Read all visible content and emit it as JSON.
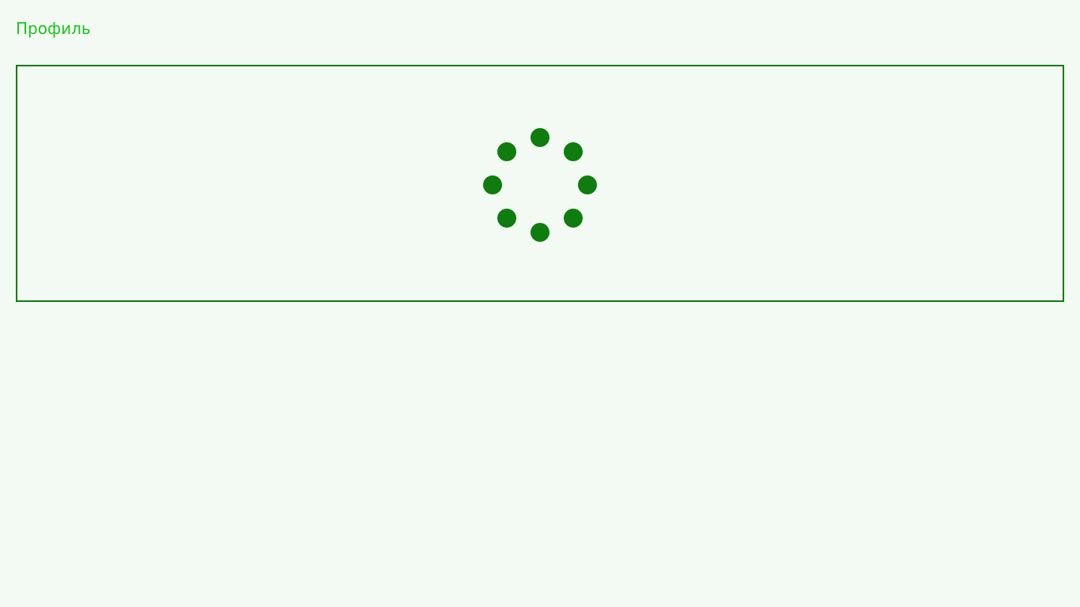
{
  "header": {
    "title": "Профиль"
  },
  "loading": {
    "spinner_icon": "loading-spinner-icon",
    "dot_count": 8,
    "color": "#0e7d0e"
  },
  "colors": {
    "background": "#f3faf3",
    "link": "#1fc21f",
    "accent": "#0e7d0e"
  }
}
